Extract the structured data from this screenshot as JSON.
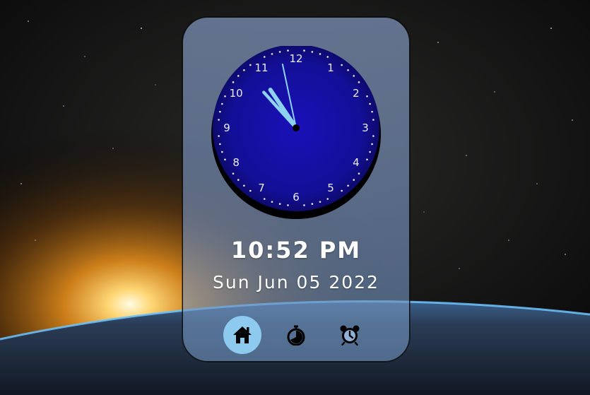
{
  "clock": {
    "numerals": [
      "12",
      "1",
      "2",
      "3",
      "4",
      "5",
      "6",
      "7",
      "8",
      "9",
      "10",
      "11"
    ],
    "hour": 10,
    "minute": 52,
    "second": 58
  },
  "time_display": "10:52 PM",
  "date_display": "Sun Jun 05 2022",
  "nav": [
    {
      "name": "home",
      "icon": "home-icon",
      "active": true
    },
    {
      "name": "stopwatch",
      "icon": "stopwatch-icon",
      "active": false
    },
    {
      "name": "alarm",
      "icon": "alarm-clock-icon",
      "active": false
    }
  ],
  "colors": {
    "dial": "#14119a",
    "hands": "#8ed2f2",
    "active_nav": "#8ec9f0"
  }
}
